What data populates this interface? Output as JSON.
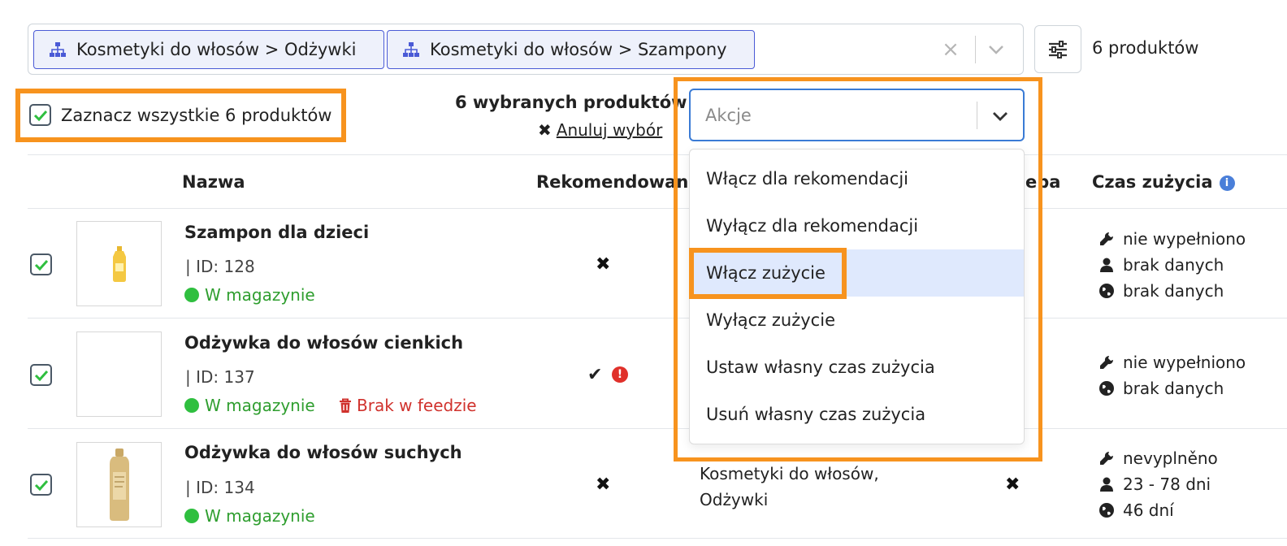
{
  "filter": {
    "chips": [
      {
        "label": "Kosmetyki do włosów > Odżywki",
        "icon": "sitemap-icon"
      },
      {
        "label": "Kosmetyki do włosów > Szampony",
        "icon": "sitemap-icon"
      }
    ],
    "clear_glyph": "×",
    "product_count": "6 produktów"
  },
  "selection": {
    "select_all_label": "Zaznacz wszystkie 6 produktów",
    "selected_text": "6 wybranych produktów",
    "cancel_glyph": "✖",
    "cancel_label": "Anuluj wybór"
  },
  "actions": {
    "placeholder": "Akcje",
    "items": [
      "Włącz dla rekomendacji",
      "Wyłącz dla rekomendacji",
      "Włącz zużycie",
      "Wyłącz zużycie",
      "Ustaw własny czas zużycia",
      "Usuń własny czas zużycia"
    ],
    "highlighted_index": 2
  },
  "table": {
    "headers": {
      "name": "Nazwa",
      "recommended": "Rekomendowane",
      "need_partial": "eba",
      "usage_time": "Czas zużycia",
      "info_glyph": "i"
    },
    "rows": [
      {
        "name": "Szampon dla dzieci",
        "id": "| ID: 128",
        "stock": "W magazynie",
        "recommended": "✖",
        "usage": [
          "nie wypełniono",
          "brak danych",
          "brak danych"
        ]
      },
      {
        "name": "Odżywka do włosów cienkich",
        "id": "| ID: 137",
        "stock": "W magazynie",
        "feed": "Brak w feedzie",
        "recommended": "✔",
        "alert": "!",
        "usage": [
          "nie wypełniono",
          "brak danych"
        ]
      },
      {
        "name": "Odżywka do włosów suchych",
        "id": "| ID: 134",
        "stock": "W magazynie",
        "recommended": "✖",
        "category_line1": "Kosmetyki do włosów,",
        "category_line2": "Odżywki",
        "need_mark": "✖",
        "usage": [
          "nevyplněno",
          "23 - 78 dni",
          "46 dní"
        ]
      }
    ]
  },
  "colors": {
    "highlight": "#f7931e",
    "primary": "#3a7bd5",
    "in_stock": "#2f9e2f",
    "danger": "#d0322d"
  }
}
